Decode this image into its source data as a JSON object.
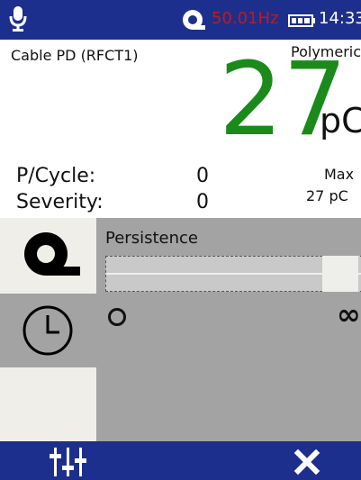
{
  "status_bar": {
    "frequency": "50.01Hz",
    "time": "14:33",
    "icons": {
      "mic": "microphone-icon",
      "sensor": "sensor-icon",
      "battery": "battery-icon"
    }
  },
  "measurement": {
    "cable_label": "Cable PD (RFCT1)",
    "cable_type": "Polymeric",
    "value": "27",
    "unit": "pC",
    "p_cycle_label": "P/Cycle:",
    "p_cycle_value": "0",
    "severity_label": "Severity:",
    "severity_value": "0",
    "max_label": "Max",
    "max_value": "27 pC"
  },
  "panel": {
    "title": "Persistence",
    "slider_level": 1.0,
    "min_symbol": "o",
    "max_symbol": "∞"
  },
  "colors": {
    "bar": "#1d2f8c",
    "value": "#1a8a1a",
    "frequency": "#c11a1a"
  }
}
